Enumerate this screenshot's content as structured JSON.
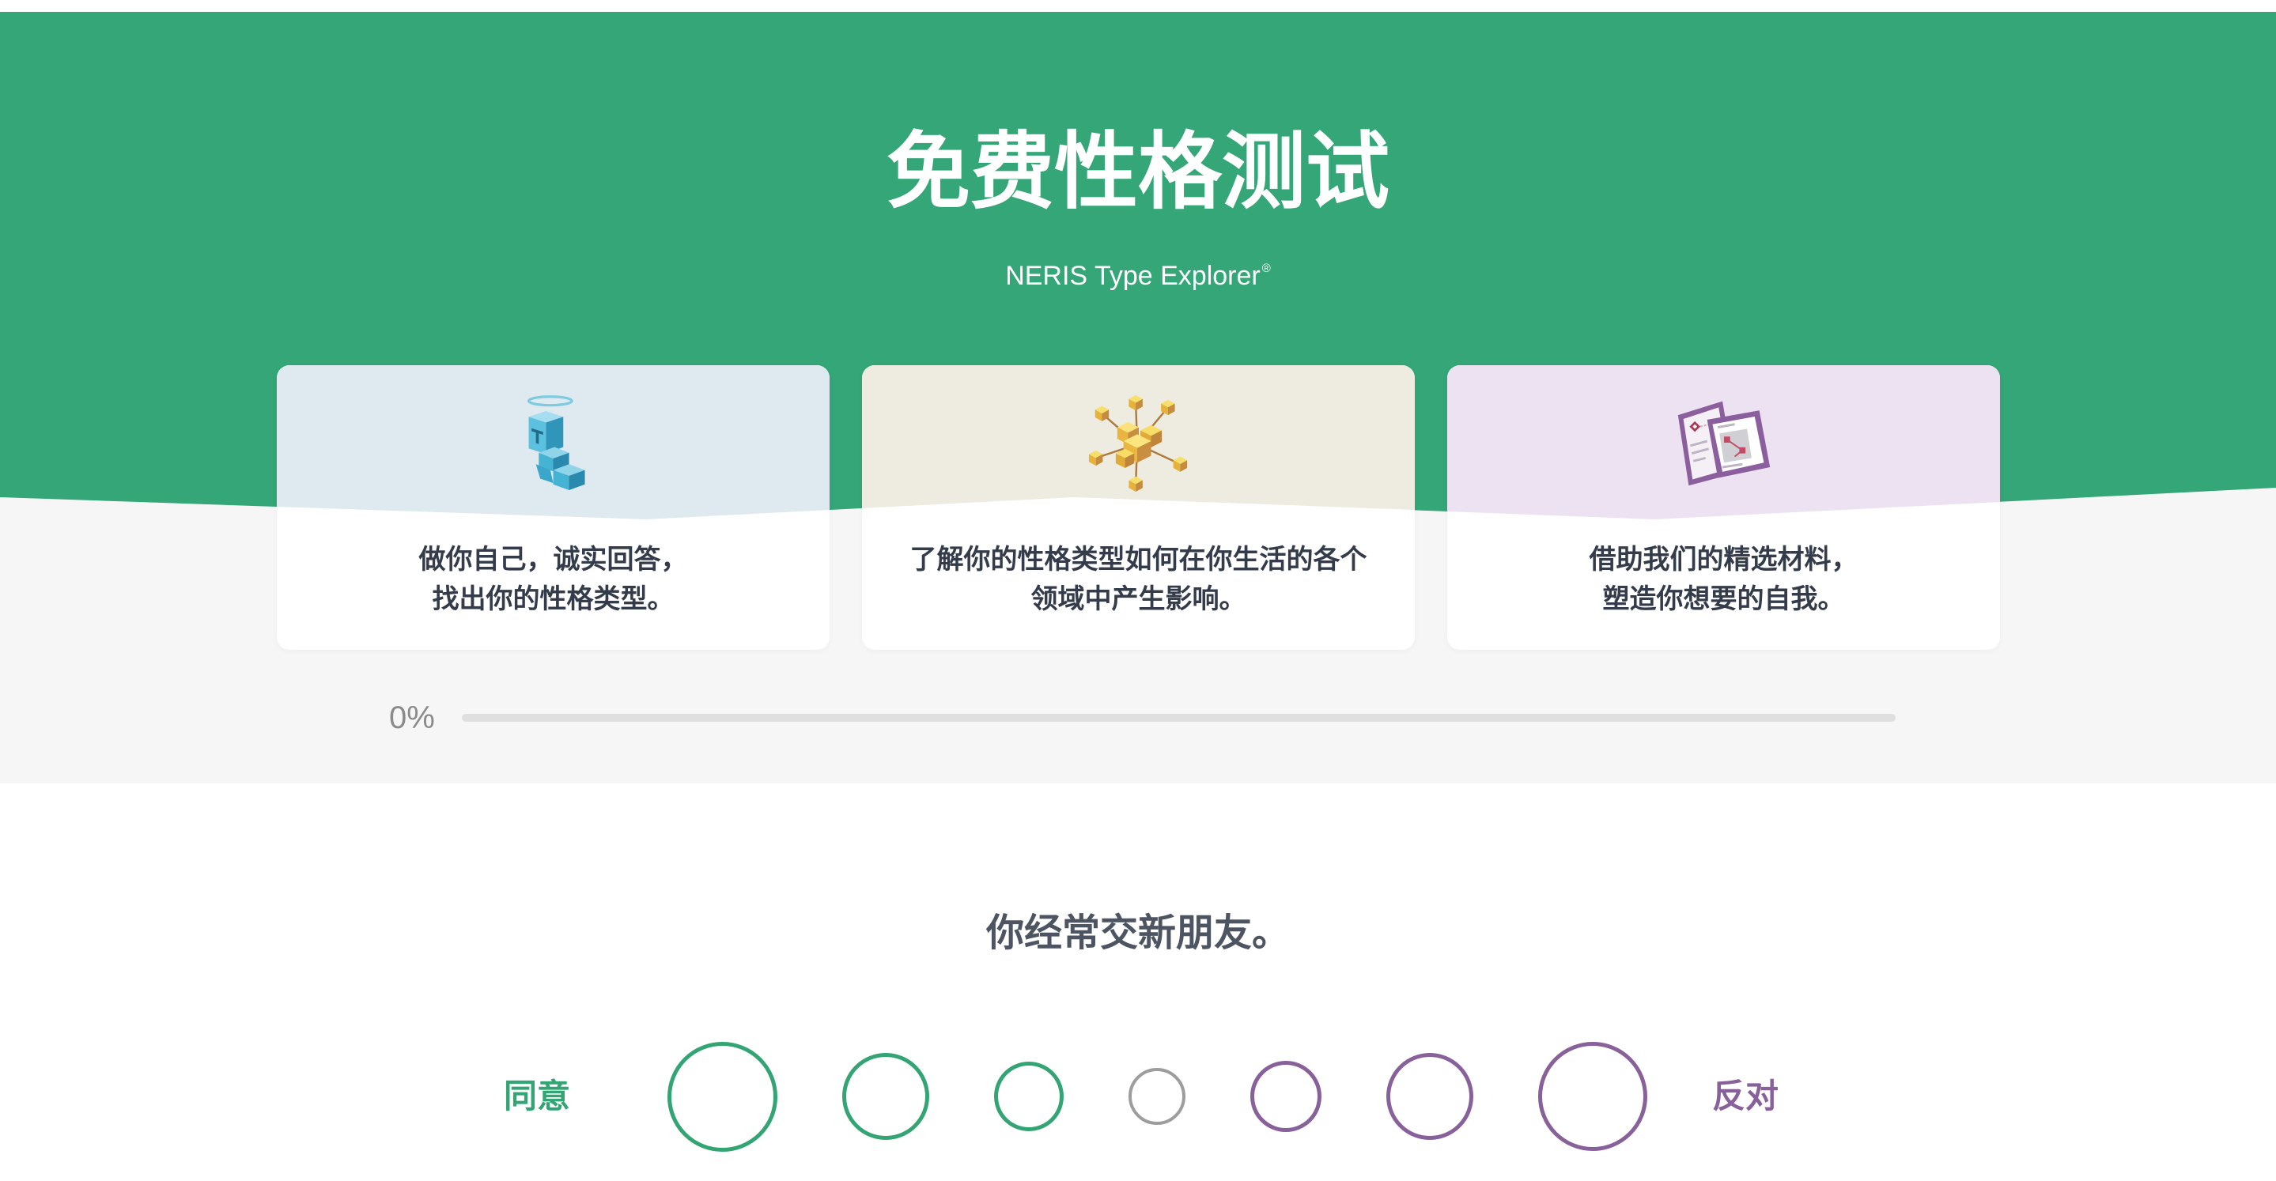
{
  "header": {
    "title": "免费性格测试",
    "subtitle": "NERIS Type Explorer",
    "subtitle_mark": "®"
  },
  "cards": [
    {
      "icon": "angel-cube-tower-icon",
      "top_color": "#dfeaf0",
      "lines": [
        "做你自己，诚实回答，",
        "找出你的性格类型。"
      ]
    },
    {
      "icon": "cube-network-icon",
      "top_color": "#eeebe1",
      "lines": [
        "了解你的性格类型如何在你生活的各个",
        "领域中产生影响。"
      ]
    },
    {
      "icon": "folded-papers-icon",
      "top_color": "#ede2f1",
      "lines": [
        "借助我们的精选材料，",
        "塑造你想要的自我。"
      ]
    }
  ],
  "progress": {
    "label": "0%",
    "value": 0
  },
  "question": {
    "text": "你经常交新朋友。"
  },
  "scale": {
    "agree_label": "同意",
    "disagree_label": "反对",
    "option_colors": [
      "#33a474",
      "#33a474",
      "#33a474",
      "#9d9d9d",
      "#88619a",
      "#88619a",
      "#88619a"
    ],
    "selected_index": null
  },
  "colors": {
    "header_green": "#34a677",
    "section_grey": "#f6f6f6",
    "card_text": "#343c4b",
    "question_text": "#4e5562",
    "agree": "#33a474",
    "disagree": "#88619a",
    "progress_track": "#dfdfdf"
  }
}
